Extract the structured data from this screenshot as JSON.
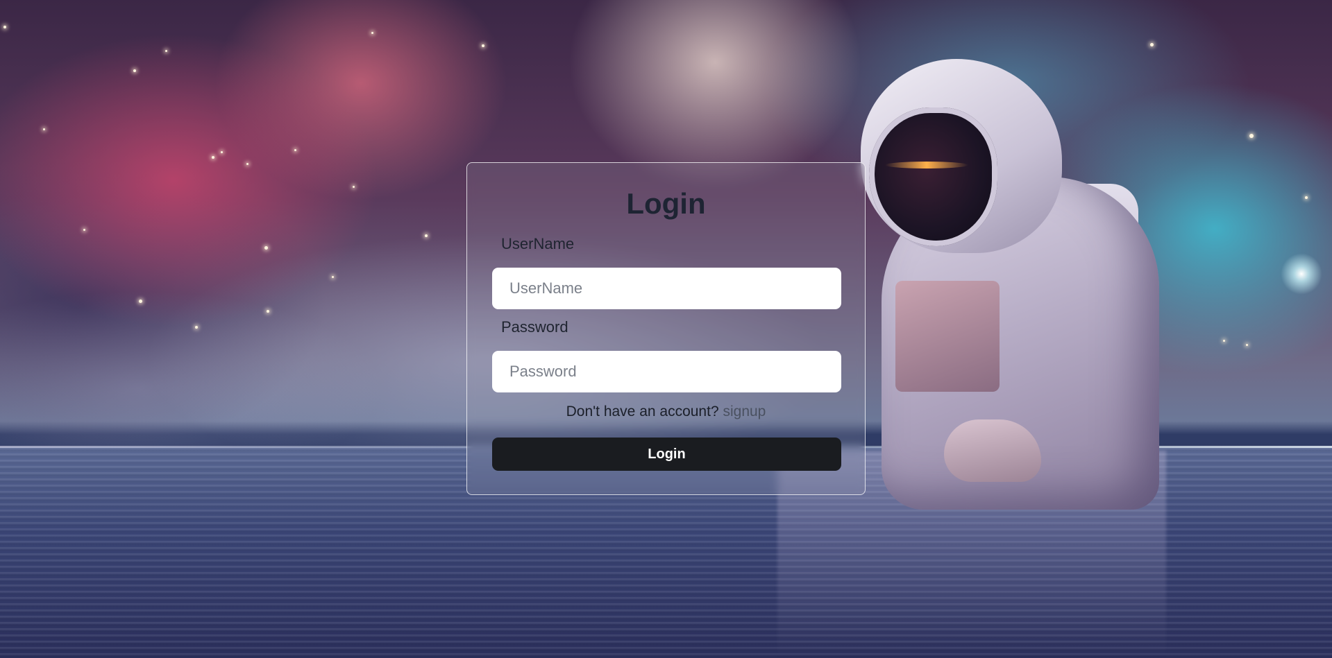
{
  "login_card": {
    "title": "Login",
    "username_label": "UserName",
    "username_placeholder": "UserName",
    "username_value": "",
    "password_label": "Password",
    "password_placeholder": "Password",
    "password_value": "",
    "signup_prompt": "Don't have an account?",
    "signup_link": "signup",
    "submit_label": "Login"
  },
  "colors": {
    "button_bg": "#1a1c20",
    "title_text": "#1e2433",
    "link_text": "#4a5160"
  },
  "background": {
    "description_icon": "astronaut-space-water-background"
  }
}
